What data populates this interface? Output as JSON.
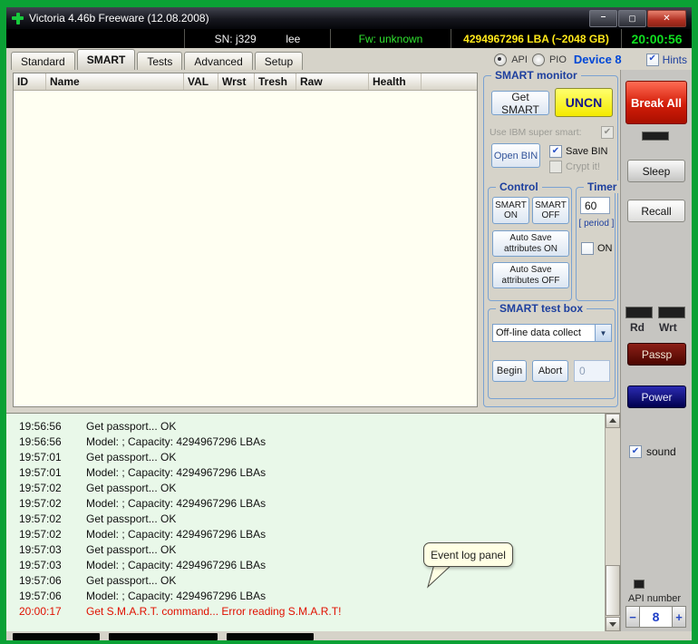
{
  "window": {
    "title": "Victoria 4.46b Freeware (12.08.2008)"
  },
  "info_bar": {
    "sn": "SN: j329",
    "owner": "lee",
    "firmware": "Fw: unknown",
    "capacity": "4294967296 LBA (~2048 GB)",
    "clock": "20:00:56"
  },
  "tab_bar": {
    "tabs": [
      {
        "label": "Standard",
        "active": false
      },
      {
        "label": "SMART",
        "active": true
      },
      {
        "label": "Tests",
        "active": false
      },
      {
        "label": "Advanced",
        "active": false
      },
      {
        "label": "Setup",
        "active": false
      }
    ],
    "api": "API",
    "pio": "PIO",
    "device": "Device 8",
    "hints": "Hints"
  },
  "smart_table": {
    "columns": [
      "ID",
      "Name",
      "VAL",
      "Wrst",
      "Tresh",
      "Raw",
      "Health"
    ]
  },
  "smart_monitor": {
    "title": "SMART monitor",
    "get_smart": "Get SMART",
    "uncn": "UNCN",
    "ibm_smart": "Use IBM super smart:",
    "open_bin": "Open BIN",
    "save_bin": "Save BIN",
    "crypt_it": "Crypt it!",
    "control": {
      "title": "Control",
      "smart_on": "SMART ON",
      "smart_off": "SMART OFF",
      "autosave_on": "Auto Save attributes ON",
      "autosave_off": "Auto Save attributes OFF"
    },
    "timer": {
      "title": "Timer",
      "period_value": "60",
      "period_label": "[ period ]",
      "on": "ON"
    },
    "test_box": {
      "title": "SMART test box",
      "selected_test": "Off-line data collect",
      "begin": "Begin",
      "abort": "Abort",
      "counter": "0"
    }
  },
  "side_panel": {
    "break_all": "Break All",
    "sleep": "Sleep",
    "recall": "Recall",
    "rd": "Rd",
    "wrt": "Wrt",
    "passp": "Passp",
    "power": "Power",
    "sound": "sound",
    "api_number": "API number",
    "api_minus": "−",
    "api_value": "8",
    "api_plus": "+"
  },
  "log": {
    "tooltip": "Event log panel",
    "entries": [
      {
        "time": "19:56:56",
        "text": "Get passport... OK",
        "error": false
      },
      {
        "time": "19:56:56",
        "text": "Model:  ; Capacity: 4294967296 LBAs",
        "error": false
      },
      {
        "time": "19:57:01",
        "text": "Get passport... OK",
        "error": false
      },
      {
        "time": "19:57:01",
        "text": "Model:  ; Capacity: 4294967296 LBAs",
        "error": false
      },
      {
        "time": "19:57:02",
        "text": "Get passport... OK",
        "error": false
      },
      {
        "time": "19:57:02",
        "text": "Model:  ; Capacity: 4294967296 LBAs",
        "error": false
      },
      {
        "time": "19:57:02",
        "text": "Get passport... OK",
        "error": false
      },
      {
        "time": "19:57:02",
        "text": "Model:  ; Capacity: 4294967296 LBAs",
        "error": false
      },
      {
        "time": "19:57:03",
        "text": "Get passport... OK",
        "error": false
      },
      {
        "time": "19:57:03",
        "text": "Model:  ; Capacity: 4294967296 LBAs",
        "error": false
      },
      {
        "time": "19:57:06",
        "text": "Get passport... OK",
        "error": false
      },
      {
        "time": "19:57:06",
        "text": "Model:  ; Capacity: 4294967296 LBAs",
        "error": false
      },
      {
        "time": "20:00:17",
        "text": "Get S.M.A.R.T. command... Error reading S.M.A.R.T!",
        "error": true
      }
    ]
  }
}
